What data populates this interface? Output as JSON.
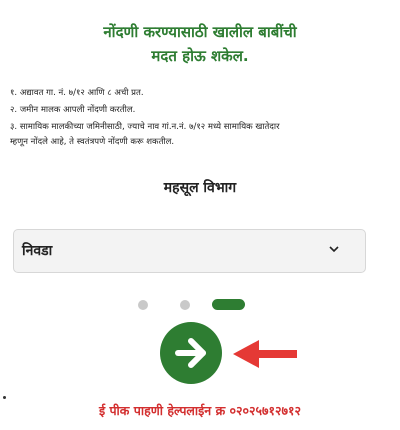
{
  "heading": {
    "line1": "नोंदणी करण्यासाठी खालील बाबींची",
    "line2": "मदत होऊ शकेल."
  },
  "points": [
    "१. अद्यावत गा. नं. ७/१२ आणि ८ अची प्रत.",
    "२. जमीन मालक आपली नोंदणी करतील.",
    "३. सामायिक मालकीच्या जमिनीसाठी, ज्याचे नाव गां.न.नं. ७/१२ मध्ये सामायिक खातेदार",
    "म्हणून नोंदले आहे, ते स्वतंत्रपणे नोंदणी करू शकतील."
  ],
  "department": {
    "label": "महसूल विभाग"
  },
  "select": {
    "value": "निवडा",
    "icon": "chevron-down-icon"
  },
  "pagination": {
    "pages": 3,
    "current": 3
  },
  "next_button": {
    "icon": "arrow-right-icon"
  },
  "helpline": {
    "text": "ई पीक पाहणी हेल्पलाईन क्र ०२०२५७१२७१२"
  },
  "colors": {
    "primary": "#2e7d32",
    "accent_red": "#d32f2f",
    "inactive_dot": "#c9c9c9"
  }
}
